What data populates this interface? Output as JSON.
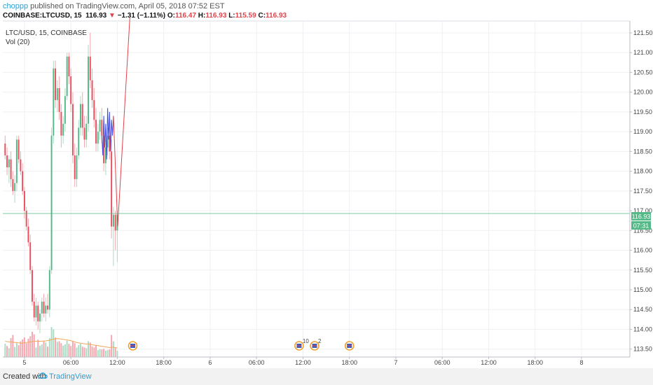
{
  "header": {
    "user": "choppp",
    "published": " published on TradingView.com, April 05, 2018 07:52 EST",
    "symbol": "COINBASE:LTCUSD, 15",
    "price": "116.93",
    "arrow": "▼",
    "change": "−1.31 (−1.11%)",
    "o_label": "O:",
    "o_value": "116.47",
    "h_label": "H:",
    "h_value": "116.93",
    "l_label": "L:",
    "l_value": "115.59",
    "c_label": "C:",
    "c_value": "116.93"
  },
  "legend": {
    "line1": "LTC/USD, 15, COINBASE",
    "line2": "Vol (20)"
  },
  "price_label": "116.93",
  "countdown_label": "07:31",
  "footer": {
    "created": "Created with",
    "brand": "TradingView"
  },
  "colors": {
    "up": "#53b987",
    "down": "#eb4d5c",
    "up_vol": "#a9dcc3",
    "down_vol": "#f5a6ae",
    "ma": "#f3a85b",
    "red_line": "#e0424a",
    "blue_line": "#3f4ee0",
    "price_line": "#53b987",
    "grid": "#eef0f3"
  },
  "chart_data": {
    "type": "candlestick",
    "yticks": [
      113.5,
      114.0,
      114.5,
      115.0,
      115.5,
      116.0,
      116.5,
      117.0,
      117.5,
      118.0,
      118.5,
      119.0,
      119.5,
      120.0,
      120.5,
      121.0,
      121.5
    ],
    "ytick_labels": [
      "113.50",
      "114.00",
      "114.50",
      "115.00",
      "115.50",
      "116.00",
      "116.50",
      "117.00",
      "117.50",
      "118.00",
      "118.50",
      "119.00",
      "119.50",
      "120.00",
      "120.50",
      "121.00",
      "121.50"
    ],
    "ylim": [
      113.3,
      121.8
    ],
    "xlim": [
      -1.2,
      323
    ],
    "xticks": [
      {
        "pos": 10,
        "label": "5"
      },
      {
        "pos": 34,
        "label": "06:00"
      },
      {
        "pos": 58,
        "label": "12:00"
      },
      {
        "pos": 82,
        "label": "18:00"
      },
      {
        "pos": 106,
        "label": "6"
      },
      {
        "pos": 130,
        "label": "06:00"
      },
      {
        "pos": 154,
        "label": "12:00"
      },
      {
        "pos": 178,
        "label": "18:00"
      },
      {
        "pos": 202,
        "label": "7"
      },
      {
        "pos": 226,
        "label": "06:00"
      },
      {
        "pos": 250,
        "label": "12:00"
      },
      {
        "pos": 274,
        "label": "18:00"
      },
      {
        "pos": 298,
        "label": "8"
      }
    ],
    "candles": [
      [
        118.7,
        118.9,
        118.3,
        118.4
      ],
      [
        118.4,
        118.6,
        117.9,
        118.1
      ],
      [
        118.1,
        118.4,
        117.7,
        118.3
      ],
      [
        118.3,
        118.5,
        117.6,
        117.8
      ],
      [
        117.8,
        118.0,
        117.4,
        117.5
      ],
      [
        117.5,
        117.9,
        117.2,
        117.7
      ],
      [
        117.7,
        118.9,
        117.5,
        118.8
      ],
      [
        118.8,
        118.9,
        118.2,
        118.3
      ],
      [
        118.3,
        118.5,
        117.9,
        118.0
      ],
      [
        118.0,
        118.2,
        117.4,
        117.5
      ],
      [
        117.5,
        117.6,
        116.8,
        117.0
      ],
      [
        117.0,
        117.1,
        116.5,
        116.6
      ],
      [
        116.6,
        116.8,
        116.1,
        116.2
      ],
      [
        116.2,
        116.4,
        115.4,
        115.5
      ],
      [
        115.5,
        115.6,
        114.6,
        114.7
      ],
      [
        114.7,
        114.9,
        114.2,
        114.3
      ],
      [
        114.3,
        114.8,
        114.1,
        114.6
      ],
      [
        114.6,
        114.7,
        114.0,
        114.2
      ],
      [
        114.2,
        114.5,
        113.9,
        114.4
      ],
      [
        114.4,
        114.8,
        114.2,
        114.7
      ],
      [
        114.7,
        114.9,
        114.3,
        114.4
      ],
      [
        114.4,
        114.8,
        114.2,
        114.6
      ],
      [
        114.6,
        114.9,
        114.4,
        114.5
      ],
      [
        114.5,
        115.6,
        114.3,
        115.5
      ],
      [
        115.5,
        119.1,
        115.4,
        118.9
      ],
      [
        118.9,
        120.8,
        118.7,
        120.6
      ],
      [
        120.6,
        120.8,
        119.6,
        119.8
      ],
      [
        119.8,
        120.3,
        119.5,
        120.1
      ],
      [
        120.1,
        120.4,
        119.3,
        119.5
      ],
      [
        119.5,
        119.7,
        118.6,
        118.9
      ],
      [
        118.9,
        119.4,
        118.7,
        119.2
      ],
      [
        119.2,
        120.1,
        119.0,
        119.9
      ],
      [
        119.9,
        121.0,
        119.8,
        120.9
      ],
      [
        120.9,
        121.0,
        120.2,
        120.4
      ],
      [
        120.4,
        120.6,
        119.5,
        119.7
      ],
      [
        119.7,
        120.0,
        118.2,
        118.4
      ],
      [
        118.4,
        118.7,
        117.6,
        117.8
      ],
      [
        117.8,
        118.6,
        117.6,
        118.4
      ],
      [
        118.4,
        119.3,
        118.3,
        119.1
      ],
      [
        119.1,
        119.9,
        118.9,
        119.7
      ],
      [
        119.7,
        120.0,
        118.9,
        119.1
      ],
      [
        119.1,
        119.4,
        118.6,
        118.8
      ],
      [
        118.8,
        119.4,
        118.6,
        119.2
      ],
      [
        119.2,
        121.2,
        119.0,
        120.9
      ],
      [
        120.9,
        121.5,
        120.1,
        120.3
      ],
      [
        120.3,
        120.6,
        119.6,
        119.8
      ],
      [
        119.8,
        120.1,
        119.1,
        119.3
      ],
      [
        119.3,
        119.6,
        118.5,
        118.7
      ],
      [
        118.7,
        119.2,
        118.5,
        119.0
      ],
      [
        119.0,
        119.5,
        118.8,
        119.3
      ],
      [
        119.3,
        119.6,
        118.7,
        118.9
      ],
      [
        118.9,
        119.2,
        118.0,
        118.2
      ],
      [
        118.2,
        118.8,
        117.9,
        118.6
      ],
      [
        118.6,
        119.1,
        118.4,
        118.9
      ],
      [
        118.9,
        119.2,
        118.3,
        118.5
      ],
      [
        118.5,
        118.8,
        116.3,
        116.6
      ],
      [
        116.6,
        117.1,
        115.6,
        116.9
      ],
      [
        116.9,
        117.0,
        116.0,
        116.5
      ],
      [
        116.5,
        117.0,
        115.7,
        116.9
      ]
    ],
    "volumes": [
      [
        0.42,
        1
      ],
      [
        0.35,
        0
      ],
      [
        0.28,
        1
      ],
      [
        0.6,
        0
      ],
      [
        0.7,
        0
      ],
      [
        0.32,
        1
      ],
      [
        0.45,
        1
      ],
      [
        0.38,
        0
      ],
      [
        0.5,
        0
      ],
      [
        0.56,
        0
      ],
      [
        0.62,
        0
      ],
      [
        0.44,
        0
      ],
      [
        0.58,
        0
      ],
      [
        0.66,
        0
      ],
      [
        0.8,
        0
      ],
      [
        0.72,
        0
      ],
      [
        0.3,
        1
      ],
      [
        0.55,
        0
      ],
      [
        0.36,
        1
      ],
      [
        0.4,
        1
      ],
      [
        0.5,
        0
      ],
      [
        0.46,
        1
      ],
      [
        0.33,
        0
      ],
      [
        0.6,
        1
      ],
      [
        0.95,
        1
      ],
      [
        0.88,
        1
      ],
      [
        0.62,
        0
      ],
      [
        0.48,
        1
      ],
      [
        0.5,
        0
      ],
      [
        0.44,
        0
      ],
      [
        0.36,
        1
      ],
      [
        0.4,
        1
      ],
      [
        0.52,
        1
      ],
      [
        0.42,
        0
      ],
      [
        0.35,
        0
      ],
      [
        0.5,
        0
      ],
      [
        0.44,
        0
      ],
      [
        0.3,
        1
      ],
      [
        0.38,
        1
      ],
      [
        0.42,
        1
      ],
      [
        0.33,
        0
      ],
      [
        0.3,
        0
      ],
      [
        0.28,
        1
      ],
      [
        0.5,
        1
      ],
      [
        0.46,
        0
      ],
      [
        0.34,
        0
      ],
      [
        0.3,
        0
      ],
      [
        0.36,
        0
      ],
      [
        0.22,
        1
      ],
      [
        0.25,
        1
      ],
      [
        0.24,
        0
      ],
      [
        0.26,
        0
      ],
      [
        0.2,
        1
      ],
      [
        0.22,
        1
      ],
      [
        0.24,
        0
      ],
      [
        0.7,
        0
      ],
      [
        0.5,
        1
      ],
      [
        0.3,
        0
      ],
      [
        0.2,
        1
      ]
    ],
    "volume_ma": [
      0.5,
      0.49,
      0.48,
      0.48,
      0.47,
      0.46,
      0.46,
      0.45,
      0.44,
      0.44,
      0.45,
      0.46,
      0.47,
      0.48,
      0.49,
      0.5,
      0.5,
      0.5,
      0.5,
      0.5,
      0.51,
      0.51,
      0.52,
      0.53,
      0.55,
      0.57,
      0.58,
      0.58,
      0.58,
      0.57,
      0.56,
      0.55,
      0.54,
      0.53,
      0.52,
      0.5,
      0.48,
      0.46,
      0.45,
      0.44,
      0.43,
      0.42,
      0.41,
      0.41,
      0.4,
      0.39,
      0.38,
      0.37,
      0.36,
      0.35,
      0.34,
      0.33,
      0.32,
      0.31,
      0.3,
      0.31,
      0.31,
      0.3,
      0.29
    ],
    "blue_line": [
      [
        50,
        118.9
      ],
      [
        50.5,
        118.4
      ],
      [
        51,
        119.4
      ],
      [
        51.5,
        118.6
      ],
      [
        52,
        119.2
      ],
      [
        52.5,
        118.3
      ],
      [
        53,
        119.6
      ],
      [
        53.5,
        118.8
      ],
      [
        54,
        119.5
      ],
      [
        54.5,
        118.5
      ],
      [
        55,
        119.3
      ],
      [
        55.5,
        118.9
      ],
      [
        56,
        119.4
      ]
    ],
    "red_line": [
      [
        56,
        119.4
      ],
      [
        58.2,
        116.6
      ],
      [
        64.5,
        121.9
      ]
    ],
    "current_price": 116.93,
    "events": [
      {
        "pos": 66,
        "label": ""
      },
      {
        "pos": 152,
        "label": "10"
      },
      {
        "pos": 160,
        "label": "2"
      },
      {
        "pos": 178,
        "label": ""
      }
    ]
  }
}
